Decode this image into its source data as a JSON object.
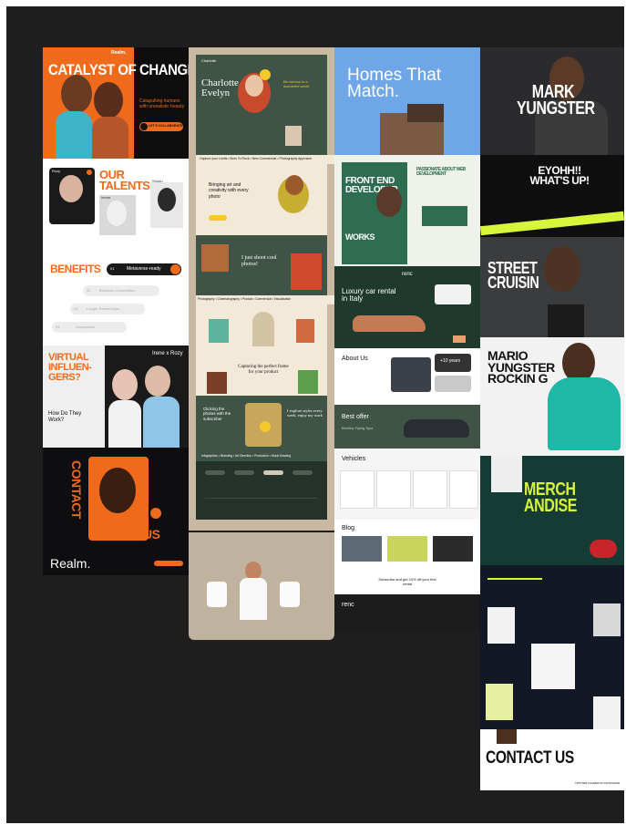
{
  "colors": {
    "canvas": "#1e1e1e",
    "realm_orange": "#f06a1b",
    "charlotte_green": "#3f5446",
    "charlotte_cream": "#f2e9d8",
    "homes_blue": "#6fa6e8",
    "renc_dark": "#1c1c1c",
    "merch_lime": "#d7f53a",
    "mark_black": "#0f0f10"
  },
  "realm": {
    "brand_top": "Realm.",
    "hero": "CATALYST OF CHANGE",
    "hero_sub": "Catapulting humans with unrealistic beauty",
    "cta": "LET'S COLLABORATE",
    "talents_title": "OUR TALENTS",
    "talent_1": "Rozy",
    "talent_2": "Imma",
    "talent_3": "Shudu",
    "benefits_title": "BENEFITS",
    "benefit_1_num": "01",
    "benefit_1": "Metaverse-ready",
    "benefit_2_num": "02",
    "benefit_2": "Business Consultation",
    "benefit_3_num": "03",
    "benefit_3": "Longer Partnerships",
    "benefit_4_num": "04",
    "benefit_4": "Uniqueness",
    "virtual_title": "VIRTUAL INFLUEN-GERS?",
    "irene": "Irene x Rozy",
    "how": "How Do They Work?",
    "contact": "CONTACT",
    "us": "US",
    "footer_brand": "Realm."
  },
  "charlotte": {
    "brand": "Charlotte",
    "hero_name": "Charlotte Evelyn",
    "tagline": "Be curious in a wonderful world",
    "marquee": "Capture your Limits  •  Born To Rock  •  New Commercial  •  Photography Approach",
    "section_title": "Bringing art and creativity with every photo",
    "shoot": "I just shoot cool photos!",
    "services": "Photography • Cinematography • Product • Commercial • Visualization",
    "capturing": "Capturing the perfect frame for your product",
    "clicking": "Clicking the photos with the subscriber",
    "explore": "I explore styles every week, enjoy my work",
    "tags": "Infographics • Branding • Art Direction • Production • Mural Drawing"
  },
  "homes": {
    "headline": "Homes That Match.",
    "frontend": "FRONT END DEVELOPER",
    "works": "WORKS",
    "passionate": "PASSIONATE ABOUT WEB DEVELOPMENT"
  },
  "renc": {
    "brand": "renc",
    "hero": "Luxury car rental in Italy",
    "about": "About Us",
    "years": "+10 years",
    "best_offer": "Best offer",
    "offer_car": "Bentley Flying Spur",
    "vehicles": "Vehicles",
    "blog": "Blog",
    "newsletter": "Subscribe and get 10% off your first rental",
    "footer_brand": "renc"
  },
  "mark": {
    "hero": "MARK YUNGSTER",
    "eyohh": "EYOHH!! WHAT'S UP!",
    "street": "STREET CRUISIN",
    "mario": "MARIO YUNGSTER ROCKIN G",
    "merch": "MERCH ANDISE",
    "contact": "CONTACT US",
    "links": "TWITTER  FACEBOOK  INSTAGRAM"
  }
}
